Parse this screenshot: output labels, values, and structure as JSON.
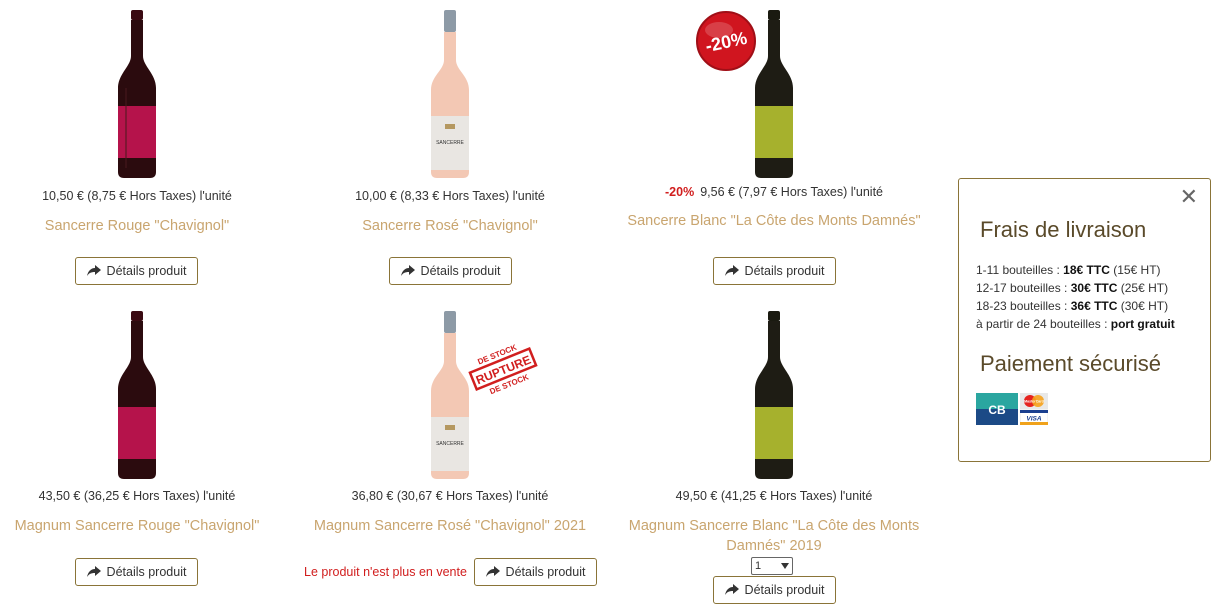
{
  "colors": {
    "accent_gold": "#c9a56f",
    "border_gold": "#8a7438",
    "discount_red": "#d11e1e",
    "red_label": "#b5134b",
    "white_label": "#c9c9c9",
    "green_label": "#a6b12d"
  },
  "products": [
    {
      "price": "10,50 € (8,75 € Hors Taxes) l'unité",
      "name": "Sancerre Rouge \"Chavignol\"",
      "button": "Détails produit",
      "bottle": "rouge"
    },
    {
      "price": "10,00 € (8,33 € Hors Taxes) l'unité",
      "name": "Sancerre Rosé \"Chavignol\"",
      "button": "Détails produit",
      "bottle": "rose",
      "label_text": "SANCERRE"
    },
    {
      "discount": "-20%",
      "badge": "-20%",
      "price": "9,56 € (7,97 € Hors Taxes) l'unité",
      "name": "Sancerre Blanc \"La Côte des Monts Damnés\"",
      "button": "Détails produit",
      "bottle": "blanc"
    },
    {
      "price": "43,50 € (36,25 € Hors Taxes) l'unité",
      "name": "Magnum Sancerre Rouge \"Chavignol\"",
      "button": "Détails produit",
      "bottle": "rouge"
    },
    {
      "price": "36,80 € (30,67 € Hors Taxes) l'unité",
      "name": "Magnum Sancerre Rosé \"Chavignol\" 2021",
      "button": "Détails produit",
      "bottle": "rose",
      "label_text": "SANCERRE",
      "stamp": {
        "top": "DE STOCK",
        "middle": "RUPTURE",
        "bottom": "DE STOCK"
      },
      "status": "Le produit n'est plus en vente"
    },
    {
      "price": "49,50 € (41,25 € Hors Taxes) l'unité",
      "name_line1": "Magnum Sancerre Blanc \"La Côte des Monts",
      "name_line2": "Damnés\" 2019",
      "quantity": "1",
      "button": "Détails produit",
      "bottle": "blanc"
    }
  ],
  "panel": {
    "close": "✕",
    "shipping_title": "Frais de livraison",
    "rates": [
      {
        "label": "1-11 bouteilles : ",
        "ttc": "18€ TTC",
        "ht": "(15€ HT)"
      },
      {
        "label": "12-17 bouteilles : ",
        "ttc": "30€ TTC",
        "ht": "(25€ HT)"
      },
      {
        "label": "18-23 bouteilles : ",
        "ttc": "36€ TTC",
        "ht": "(30€ HT)"
      }
    ],
    "free_label": "à partir de 24 bouteilles : ",
    "free_value": "port gratuit",
    "payment_title": "Paiement sécurisé",
    "cards": {
      "cb": "CB",
      "mastercard": "MasterCard",
      "visa": "VISA"
    }
  }
}
